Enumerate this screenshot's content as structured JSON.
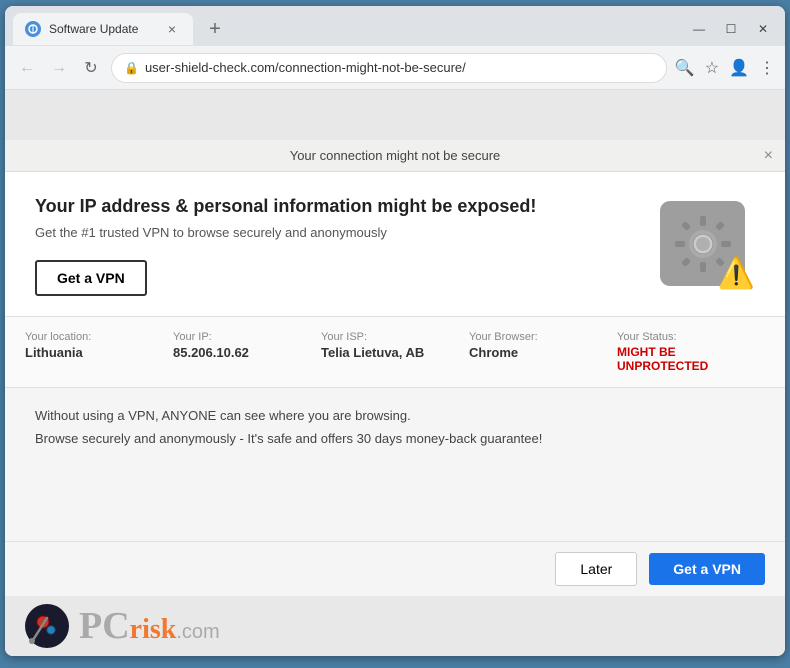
{
  "browser": {
    "tab_title": "Software Update",
    "tab_close": "×",
    "new_tab": "+",
    "url": "user-shield-check.com/connection-might-not-be-secure/",
    "window_controls": {
      "minimize": "—",
      "maximize": "☐",
      "close": "✕"
    }
  },
  "info_bar": {
    "message": "Your connection might not be secure",
    "close": "×"
  },
  "main": {
    "headline": "Your IP address & personal information might be exposed!",
    "subheadline": "Get the #1 trusted VPN to browse securely and anonymously",
    "get_vpn_label": "Get a VPN"
  },
  "info_strip": {
    "items": [
      {
        "label": "Your location:",
        "value": "Lithuania"
      },
      {
        "label": "Your IP:",
        "value": "85.206.10.62"
      },
      {
        "label": "Your ISP:",
        "value": "Telia Lietuva, AB"
      },
      {
        "label": "Your Browser:",
        "value": "Chrome"
      },
      {
        "label": "Your Status:",
        "value": "MIGHT BE UNPROTECTED",
        "is_red": true
      }
    ]
  },
  "warning": {
    "line1": "Without using a VPN, ANYONE can see where you are browsing.",
    "line2": "Browse securely and anonymously - It's safe and offers 30 days money-back guarantee!"
  },
  "bottom_cta": {
    "later_label": "Later",
    "get_vpn_label": "Get a VPN"
  },
  "footer": {
    "logo_text": "PC",
    "risk_text": "risk",
    "dot_com": ".com"
  }
}
